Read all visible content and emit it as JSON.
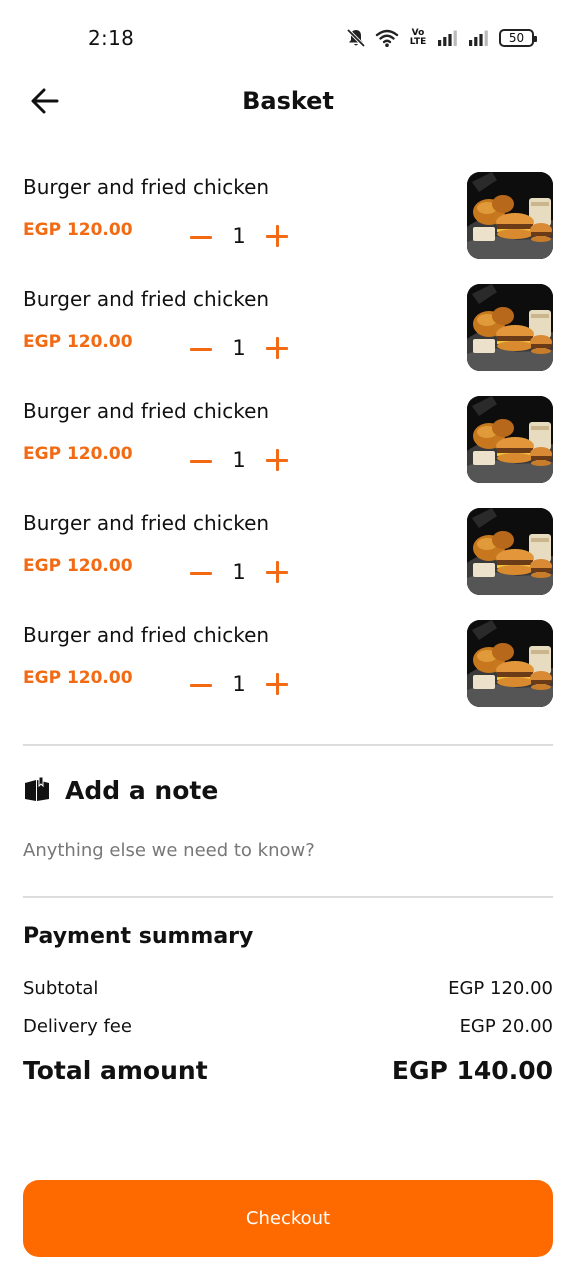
{
  "status_bar": {
    "time": "2:18",
    "volte": "Vo LTE",
    "battery": "50",
    "icons": [
      "bell-off-icon",
      "wifi-icon",
      "volte-icon",
      "signal-icon",
      "signal-icon",
      "battery-icon"
    ]
  },
  "header": {
    "back_icon": "arrow-left-icon",
    "title": "Basket"
  },
  "items": [
    {
      "name": "Burger and fried chicken",
      "price": "EGP 120.00",
      "quantity": "1"
    },
    {
      "name": "Burger and fried chicken",
      "price": "EGP 120.00",
      "quantity": "1"
    },
    {
      "name": "Burger and fried chicken",
      "price": "EGP 120.00",
      "quantity": "1"
    },
    {
      "name": "Burger and fried chicken",
      "price": "EGP 120.00",
      "quantity": "1"
    },
    {
      "name": "Burger and fried chicken",
      "price": "EGP 120.00",
      "quantity": "1"
    }
  ],
  "note": {
    "icon": "note-icon",
    "title": "Add a note",
    "placeholder": "Anything else we need to know?",
    "value": ""
  },
  "payment_summary": {
    "title": "Payment summary",
    "subtotal_label": "Subtotal",
    "subtotal_value": "EGP 120.00",
    "delivery_label": "Delivery fee",
    "delivery_value": "EGP 20.00",
    "total_label": "Total amount",
    "total_value": "EGP 140.00"
  },
  "checkout": {
    "label": "Checkout"
  },
  "colors": {
    "accent": "#f26a13",
    "button": "#ff6a00",
    "divider": "#dcdcdc",
    "text": "#111111"
  }
}
